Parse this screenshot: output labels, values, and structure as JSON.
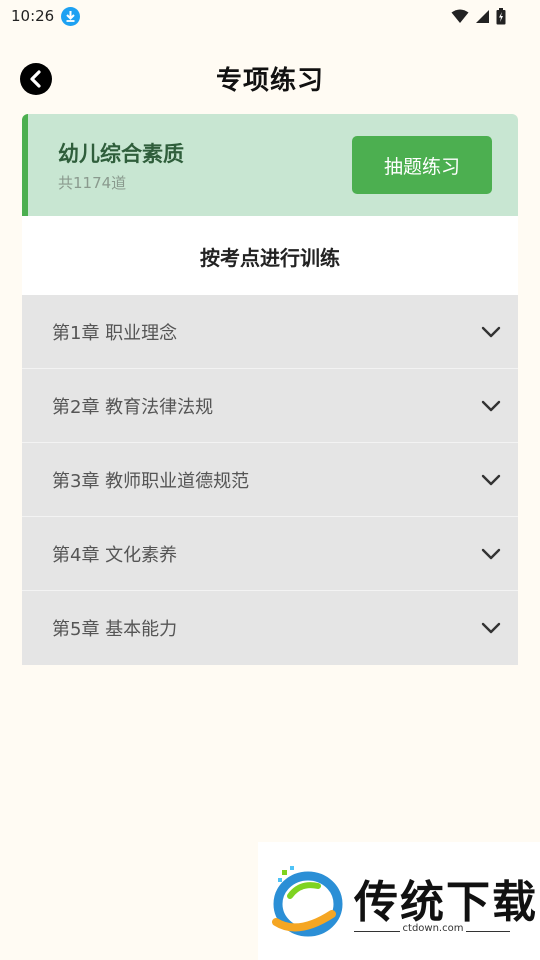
{
  "status_bar": {
    "time": "10:26"
  },
  "header": {
    "title": "专项练习"
  },
  "summary": {
    "subject": "幼儿综合素质",
    "count_text": "共1174道",
    "practice_button": "抽题练习"
  },
  "section": {
    "title": "按考点进行训练"
  },
  "chapters": [
    {
      "label": "第1章 职业理念"
    },
    {
      "label": "第2章 教育法律法规"
    },
    {
      "label": "第3章 教师职业道德规范"
    },
    {
      "label": "第4章 文化素养"
    },
    {
      "label": "第5章 基本能力"
    }
  ],
  "watermark": {
    "brand": "传统下载",
    "url": "ctdown.com"
  },
  "colors": {
    "accent_green": "#4caf50",
    "card_bg": "#c8e6d2",
    "page_bg": "#fffbf3",
    "row_bg": "#e5e5e5"
  }
}
